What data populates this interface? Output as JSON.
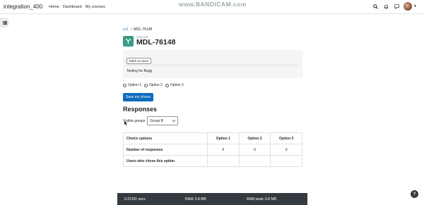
{
  "navbar": {
    "site_name": "integration_400",
    "links": [
      "Home",
      "Dashboard",
      "My courses"
    ],
    "watermark": "www.BANDICAM.com",
    "icons": [
      "search-icon",
      "bell-icon",
      "chat-icon",
      "avatar"
    ]
  },
  "breadcrumb": {
    "course": "cc1",
    "separator": "/",
    "current": "MDL-76148"
  },
  "header": {
    "module_type": "CHOICE",
    "title": "MDL-76148"
  },
  "intro": {
    "mark_done_label": "Mark as done",
    "text": "Testing for Bugg"
  },
  "options": [
    "Option 1",
    "Option 2",
    "Option 3"
  ],
  "save_button": "Save my choice",
  "responses": {
    "title": "Responses",
    "visible_groups_label": "Visible groups",
    "group_selected": "Group B"
  },
  "table": {
    "headers": [
      "Choice options",
      "Option 1",
      "Option 2",
      "Option 3"
    ],
    "rows": [
      {
        "label": "Number of responses",
        "values": [
          "0",
          "0",
          "0"
        ]
      },
      {
        "label": "Users who chose this option",
        "values": [
          "",
          "",
          ""
        ]
      }
    ]
  },
  "footer": {
    "time": "0.22191 secs",
    "ram": "RAM: 5.8 MB",
    "ram_peak": "RAM peak: 6.8 MB"
  },
  "help_label": "?"
}
